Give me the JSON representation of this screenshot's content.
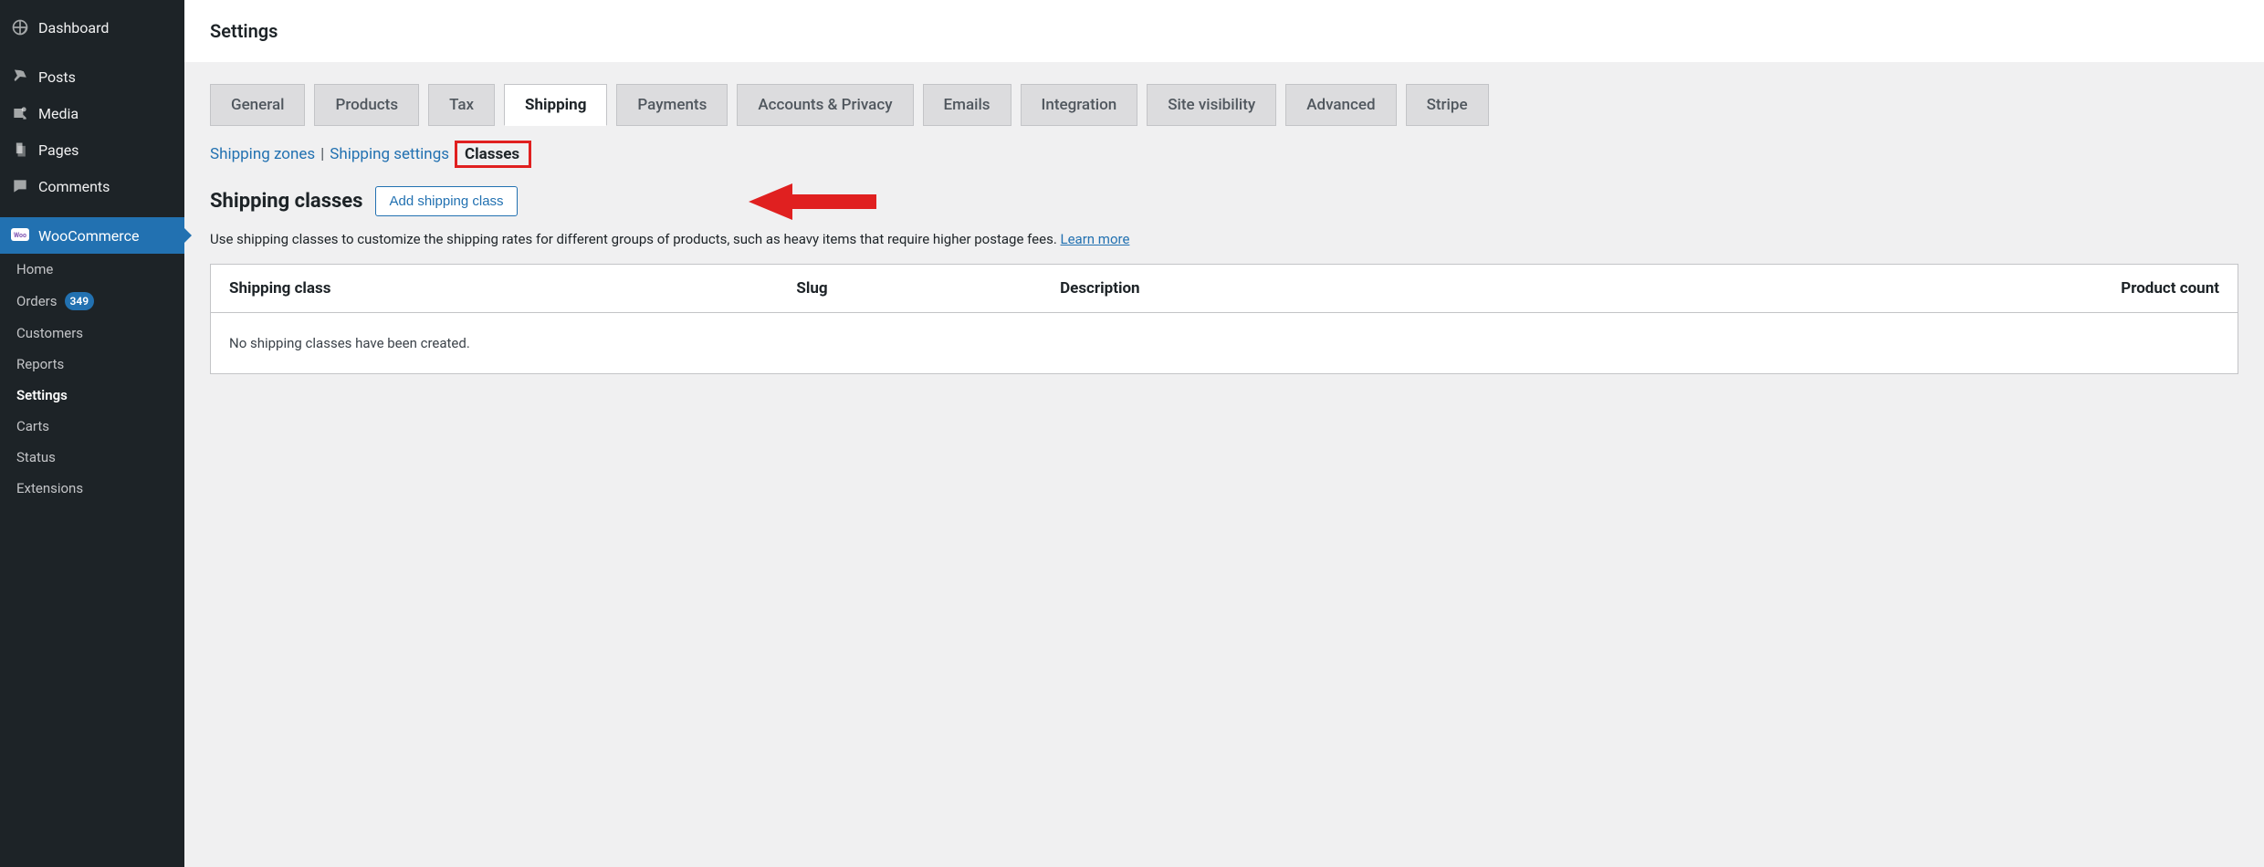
{
  "sidebar": {
    "main": [
      {
        "label": "Dashboard",
        "icon": "dashboard"
      },
      {
        "label": "Posts",
        "icon": "pin"
      },
      {
        "label": "Media",
        "icon": "media"
      },
      {
        "label": "Pages",
        "icon": "pages"
      },
      {
        "label": "Comments",
        "icon": "comment"
      },
      {
        "label": "WooCommerce",
        "icon": "woo",
        "active": true
      }
    ],
    "sub": [
      {
        "label": "Home"
      },
      {
        "label": "Orders",
        "badge": "349"
      },
      {
        "label": "Customers"
      },
      {
        "label": "Reports"
      },
      {
        "label": "Settings",
        "current": true
      },
      {
        "label": "Carts"
      },
      {
        "label": "Status"
      },
      {
        "label": "Extensions"
      }
    ]
  },
  "header": {
    "title": "Settings"
  },
  "tabs": [
    "General",
    "Products",
    "Tax",
    "Shipping",
    "Payments",
    "Accounts & Privacy",
    "Emails",
    "Integration",
    "Site visibility",
    "Advanced",
    "Stripe"
  ],
  "active_tab": "Shipping",
  "subnav": {
    "zones": "Shipping zones",
    "settings": "Shipping settings",
    "classes": "Classes"
  },
  "page": {
    "heading": "Shipping classes",
    "add_button": "Add shipping class",
    "description_pre": "Use shipping classes to customize the shipping rates for different groups of products, such as heavy items that require higher postage fees. ",
    "learn_more": "Learn more"
  },
  "table": {
    "columns": [
      "Shipping class",
      "Slug",
      "Description",
      "Product count"
    ],
    "empty": "No shipping classes have been created."
  }
}
